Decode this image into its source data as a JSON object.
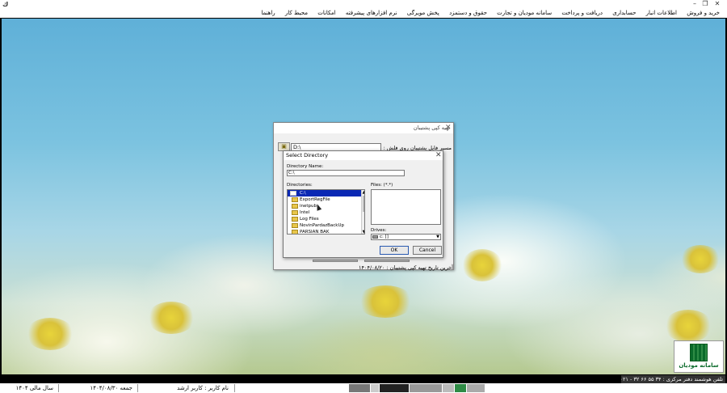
{
  "window": {
    "app_icon": "ﻙ",
    "minimize": "–",
    "restore": "❐",
    "close": "✕"
  },
  "menu": [
    "خرید و فروش",
    "اطلاعات انبار",
    "حسابداری",
    "دریافت و پرداخت",
    "سامانه مودیان و تجارت",
    "حقوق و دستمزد",
    "پخش مویرگی",
    "نرم افزارهای پیشرفته",
    "امکانات",
    "محیط کار",
    "راهنما"
  ],
  "backup_dialog": {
    "title": "تهیه کپی پشتیبان",
    "close": "✕",
    "path_label": "مسیر فایل پشتیبان روی فلش :",
    "path_value": "D:\\",
    "browse_icon": "folder-browse-icon",
    "last_backup": "آخرین تاریخ تهیه کپی پشتیبان : ۱۴۰۴/۰۸/۲۰"
  },
  "select_directory": {
    "title": "Select Directory",
    "close": "✕",
    "directory_name_label": "Directory Name:",
    "directory_name_value": "C:\\",
    "directories_label": "Directories:",
    "files_label": "Files: (*.*)",
    "drives_label": "Drives:",
    "drive_value": "c: []",
    "directories": [
      "C:\\",
      "ExportRegFile",
      "inetpub",
      "Intel",
      "Log Files",
      "NovinPardazBackUp",
      "PARSIAN BAK"
    ],
    "ok_label": "OK",
    "cancel_label": "Cancel"
  },
  "logo": {
    "text": "سامانه مودیان"
  },
  "support_phone": "تلفن هوشمند دفتر مرکزی : ۳۴ ۵۵ ۶۶ ۳۲ - ۰۲۱",
  "statusbar": {
    "username": "نام کاربر : کاربر ارشد",
    "day_date": "جمعه   ۱۴۰۴/۰۸/۳۰",
    "fiscal_year": "سال مالی ۱۴۰۴"
  }
}
